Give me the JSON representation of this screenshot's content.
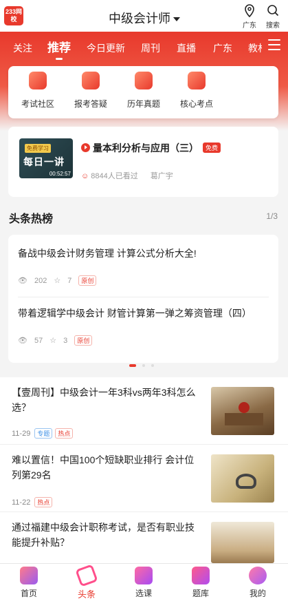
{
  "header": {
    "logo_text": "233网校",
    "title": "中级会计师",
    "location_label": "广东",
    "search_label": "搜索"
  },
  "tabs": [
    "关注",
    "推荐",
    "今日更新",
    "周刊",
    "直播",
    "广东",
    "教材"
  ],
  "quick": [
    "考试社区",
    "报考答疑",
    "历年真题",
    "核心考点"
  ],
  "live": {
    "badge": "免费学习",
    "thumb_text": "每日一讲",
    "duration": "00:52:57",
    "title": "量本利分析与应用（三）",
    "free_label": "免费",
    "viewers": "8844人已看过",
    "teacher": "葛广宇"
  },
  "hot": {
    "heading": "头条热榜",
    "page": "1/3",
    "items": [
      {
        "title": "备战中级会计财务管理  计算公式分析大全!",
        "views": "202",
        "likes": "7",
        "tag": "原创"
      },
      {
        "title": "带着逻辑学中级会计 财管计算第一弹之筹资管理（四）",
        "views": "57",
        "likes": "3",
        "tag": "原创"
      }
    ]
  },
  "news": [
    {
      "title": "【壹周刊】中级会计一年3科vs两年3科怎么选？",
      "date": "11-29",
      "tags": [
        "专题",
        "热点"
      ]
    },
    {
      "title": "难以置信！中国100个短缺职业排行 会计位列第29名",
      "date": "11-22",
      "tags": [
        "热点"
      ]
    },
    {
      "title": "通过福建中级会计职称考试，是否有职业技能提升补贴？",
      "date": "",
      "tags": []
    }
  ],
  "nav": [
    "首页",
    "头条",
    "选课",
    "题库",
    "我的"
  ],
  "colors": {
    "brand": "#e8392c"
  }
}
